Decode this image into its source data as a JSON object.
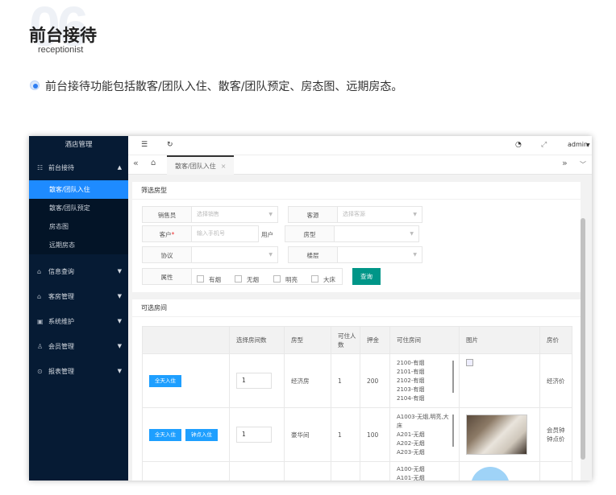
{
  "section": {
    "number": "06",
    "title": "前台接待",
    "subtitle": "receptionist",
    "description": "前台接待功能包括散客/团队入住、散客/团队预定、房态图、远期房态。"
  },
  "app": {
    "sidebar": {
      "brand": "酒店管理",
      "groups": [
        {
          "label": "前台接待",
          "icon": "reception-icon"
        },
        {
          "label": "信息查询",
          "icon": "house-icon"
        },
        {
          "label": "客房管理",
          "icon": "house-icon"
        },
        {
          "label": "系统维护",
          "icon": "wrench-icon"
        },
        {
          "label": "会员管理",
          "icon": "member-icon"
        },
        {
          "label": "报表管理",
          "icon": "report-icon"
        }
      ],
      "subitems": [
        "散客/团队入住",
        "散客/团队预定",
        "房态图",
        "远期房态"
      ]
    },
    "topbar": {
      "user": "admin"
    },
    "tabs": {
      "active": "散客/团队入住",
      "close": "×"
    },
    "filter": {
      "title": "筛选房型",
      "labels": {
        "salesperson": "销售员",
        "guest_source": "客源",
        "customer": "客户",
        "customer_mark": "*",
        "user": "用户",
        "room_type": "房型",
        "agreement": "协议",
        "floor": "楼层",
        "attribute": "属性"
      },
      "placeholders": {
        "salesperson": "选择销售",
        "guest_source": "选择客源",
        "phone": "输入手机号"
      },
      "attributes": [
        "有烟",
        "无烟",
        "明亮",
        "大床"
      ],
      "query": "查询"
    },
    "rooms": {
      "title": "可选房间",
      "headers": [
        "选择房间数",
        "房型",
        "可住人数",
        "押金",
        "可住房间",
        "图片",
        "房价"
      ],
      "rows": [
        {
          "buttons": [
            "全天入住"
          ],
          "count": "1",
          "type": "经济房",
          "people": "1",
          "deposit": "200",
          "list": [
            "2100-有烟",
            "2101-有烟",
            "2102-有烟",
            "2103-有烟",
            "2104-有烟"
          ],
          "price": "经济价"
        },
        {
          "buttons": [
            "全天入住",
            "钟点入住"
          ],
          "count": "1",
          "type": "豪华间",
          "people": "1",
          "deposit": "100",
          "list": [
            "A1003-无烟,明亮,大",
            "床",
            "A201-无烟",
            "A202-无烟",
            "A203-无烟"
          ],
          "price": "会员钟\n钟点价"
        },
        {
          "list": [
            "A100-无烟",
            "A101-无烟"
          ]
        }
      ]
    }
  }
}
